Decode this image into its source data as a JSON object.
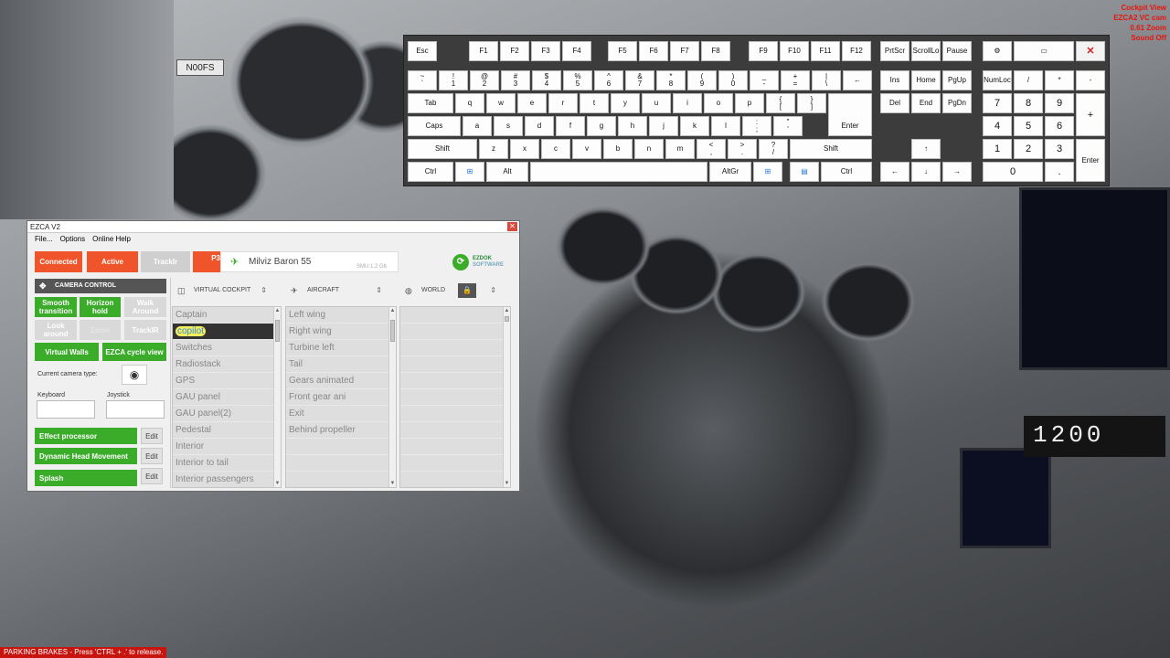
{
  "sim_overlay": {
    "lines": [
      "Cockpit View",
      "EZCA2 VC cam",
      "0.61 Zoom",
      "Sound Off"
    ]
  },
  "status_message": "PARKING BRAKES - Press 'CTRL + .' to release.",
  "cockpit": {
    "tail_number": "N00FS",
    "freq_display": "1200"
  },
  "keyboard": {
    "rows": [
      [
        "Esc",
        "F1",
        "F2",
        "F3",
        "F4",
        "F5",
        "F6",
        "F7",
        "F8",
        "F9",
        "F10",
        "F11",
        "F12",
        "PrtScr",
        "ScrollLo",
        "Pause"
      ],
      [
        "~\n`",
        "!\n1",
        "@\n2",
        "#\n3",
        "$\n4",
        "%\n5",
        "^\n6",
        "&\n7",
        "*\n8",
        "(\n9",
        ")\n0",
        "_\n-",
        "+\n=",
        "|\n\\",
        "←",
        "Ins",
        "Home",
        "PgUp",
        "NumLoc",
        "/",
        "*",
        "-"
      ],
      [
        "Tab",
        "q",
        "w",
        "e",
        "r",
        "t",
        "y",
        "u",
        "i",
        "o",
        "p",
        "{\n[",
        "}\n]",
        "Enter",
        "Del",
        "End",
        "PgDn",
        "7",
        "8",
        "9",
        "+"
      ],
      [
        "Caps",
        "a",
        "s",
        "d",
        "f",
        "g",
        "h",
        "j",
        "k",
        "l",
        ":\n;",
        "\"\n'",
        "4",
        "5",
        "6"
      ],
      [
        "Shift",
        "z",
        "x",
        "c",
        "v",
        "b",
        "n",
        "m",
        "<\n,",
        ">\n.",
        "?\n/",
        "Shift",
        "↑",
        "1",
        "2",
        "3",
        "Enter"
      ],
      [
        "Ctrl",
        "Alt",
        "AltGr",
        "Ctrl",
        "←",
        "↓",
        "→",
        "0",
        "."
      ]
    ],
    "close_label": "✕"
  },
  "ezca": {
    "title": "EZCA V2",
    "menu": [
      "File...",
      "Options",
      "Online Help"
    ],
    "top_buttons": {
      "connected": "Connected",
      "active": "Active",
      "trackir": "TrackIr",
      "p3d": "P3D"
    },
    "aircraft_name": "Milviz Baron 55",
    "smu": "SMU:1.2 Gb",
    "logo_text": [
      "EZDOK",
      "SOFTWARE"
    ],
    "camera_control": "CAMERA CONTROL",
    "mode_buttons": [
      "Smooth\ntransition",
      "Horizon\nhold",
      "Walk\nAround",
      "Look\naround",
      "Zoom",
      "TrackIR"
    ],
    "virtual_walls": "Virtual Walls",
    "ezca_cycle": "EZCA cycle view",
    "current_camera_label": "Current camera type:",
    "keyboard_label": "Keyboard",
    "joystick_label": "Joystick",
    "effects": [
      {
        "label": "Effect processor",
        "edit": "Edit"
      },
      {
        "label": "Dynamic Head Movement",
        "edit": "Edit"
      },
      {
        "label": "Splash",
        "edit": "Edit"
      }
    ],
    "columns": {
      "virtual_cockpit": "VIRTUAL COCKPIT",
      "aircraft": "AIRCRAFT",
      "world": "WORLD"
    },
    "virtual_cockpit_items": [
      "Captain",
      "copilot",
      "Switches",
      "Radiostack",
      "GPS",
      "GAU panel",
      "GAU panel(2)",
      "Pedestal",
      "Interior",
      "Interior to tail",
      "Interior passengers"
    ],
    "selected_vc_item": "copilot",
    "aircraft_items": [
      "Left wing",
      "Right wing",
      "Turbine left",
      "Tail",
      "Gears animated",
      "Front gear ani",
      "Exit",
      "Behind propeller"
    ],
    "world_items": []
  }
}
